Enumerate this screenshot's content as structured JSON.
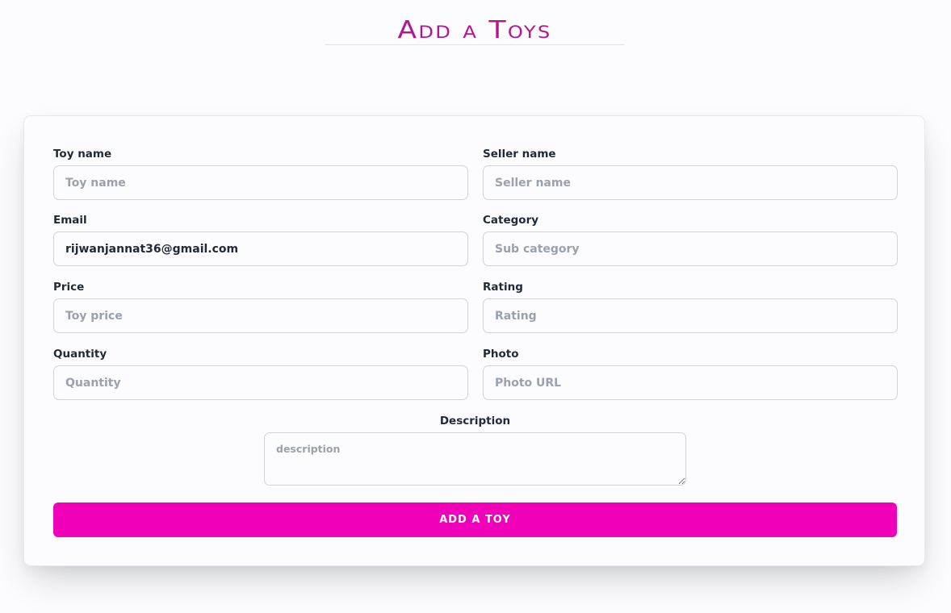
{
  "header": {
    "title": "Add a Toys"
  },
  "form": {
    "toy_name": {
      "label": "Toy name",
      "placeholder": "Toy name",
      "value": ""
    },
    "seller_name": {
      "label": "Seller name",
      "placeholder": "Seller name",
      "value": ""
    },
    "email": {
      "label": "Email",
      "placeholder": "",
      "value": "rijwanjannat36@gmail.com"
    },
    "category": {
      "label": "Category",
      "placeholder": "Sub category",
      "value": ""
    },
    "price": {
      "label": "Price",
      "placeholder": "Toy price",
      "value": ""
    },
    "rating": {
      "label": "Rating",
      "placeholder": "Rating",
      "value": ""
    },
    "quantity": {
      "label": "Quantity",
      "placeholder": "Quantity",
      "value": ""
    },
    "photo": {
      "label": "Photo",
      "placeholder": "Photo URL",
      "value": ""
    },
    "description": {
      "label": "Description",
      "placeholder": "description",
      "value": ""
    },
    "submit_label": "Add a Toy"
  },
  "colors": {
    "accent": "#f000b8",
    "title": "#b5168f"
  }
}
